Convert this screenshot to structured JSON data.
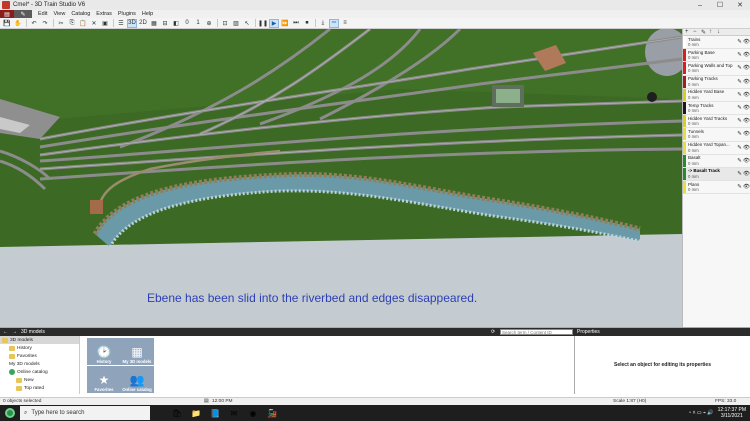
{
  "window": {
    "title": "Cmel* - 3D Train Studio V6",
    "controls": [
      "–",
      "☐",
      "✕"
    ]
  },
  "menu": {
    "file_label": "",
    "items": [
      "Edit",
      "View",
      "Catalog",
      "Extras",
      "Plugins",
      "Help"
    ]
  },
  "toolbar": {
    "view_3d": "3D",
    "view_2d": "2D",
    "page_label": "0",
    "page_value": "1"
  },
  "caption": "Ebene has been slid into the riverbed and edges disappeared.",
  "layers": [
    {
      "name": "Trains",
      "height": "0 mm",
      "color": "#ffffff"
    },
    {
      "name": "Parking Base",
      "height": "0 mm",
      "color": "#d62020"
    },
    {
      "name": "Parking Walls and Top",
      "height": "0 mm",
      "color": "#d62020"
    },
    {
      "name": "Parking Tracks",
      "height": "0 mm",
      "color": "#a02020"
    },
    {
      "name": "Hidden Yard Base",
      "height": "0 mm",
      "color": "#d6d020"
    },
    {
      "name": "Temp Tracks",
      "height": "0 mm",
      "color": "#1a1a1a"
    },
    {
      "name": "Hidden Yard Tracks",
      "height": "0 mm",
      "color": "#d6d020"
    },
    {
      "name": "Tunnels",
      "height": "0 mm",
      "color": "#e0e040"
    },
    {
      "name": "Hidden Yard Topan...",
      "height": "0 mm",
      "color": "#e0e040"
    },
    {
      "name": "Basalt",
      "height": "0 mm",
      "color": "#2a8a2a"
    },
    {
      "name": "-> Basalt Track",
      "height": "0 mm",
      "color": "#2a8a2a",
      "selected": true
    },
    {
      "name": "Plans",
      "height": "0 mm",
      "color": "#e0e040"
    }
  ],
  "catalog": {
    "header": "3D models",
    "search_placeholder": "Search term / Content ID",
    "tree": [
      {
        "label": "3D models",
        "kind": "folder",
        "indent": 0,
        "highlight": true
      },
      {
        "label": "History",
        "kind": "folder",
        "indent": 1
      },
      {
        "label": "Favorites",
        "kind": "folder",
        "indent": 1
      },
      {
        "label": "My 3D models",
        "kind": "none",
        "indent": 1
      },
      {
        "label": "Online catalog",
        "kind": "globe",
        "indent": 1
      },
      {
        "label": "New",
        "kind": "folder",
        "indent": 2
      },
      {
        "label": "Top rated",
        "kind": "folder",
        "indent": 2
      }
    ],
    "tiles": [
      {
        "label": "History",
        "glyph": "🕑"
      },
      {
        "label": "My 3D models",
        "glyph": "▦"
      },
      {
        "label": "Favorites",
        "glyph": "★"
      },
      {
        "label": "Online catalog",
        "glyph": "👥"
      }
    ]
  },
  "properties": {
    "header": "Properties",
    "empty_text": "Select an object for editing its properties"
  },
  "status": {
    "selection": "0 objects selected",
    "time": "12:00 PM",
    "scale": "Scale 1:87 (H0)",
    "fps": "FPS: 33.0"
  },
  "taskbar": {
    "search_placeholder": "Type here to search",
    "clock_time": "12:17:37 PM",
    "clock_date": "3/11/2021"
  },
  "colors": {
    "caption": "#2d3fb7",
    "grass": "#3c6a24",
    "ground": "#c4ccd2"
  }
}
